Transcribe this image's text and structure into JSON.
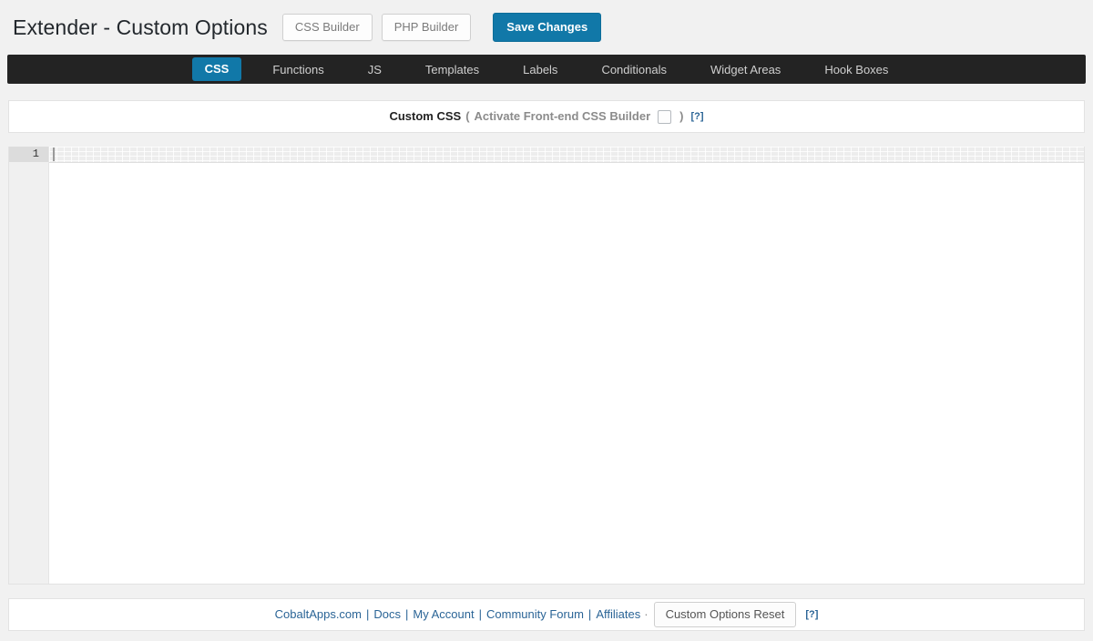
{
  "header": {
    "title": "Extender - Custom Options",
    "buttons": [
      {
        "label": "CSS Builder",
        "name": "css-builder-button"
      },
      {
        "label": "PHP Builder",
        "name": "php-builder-button"
      }
    ],
    "save_label": "Save Changes",
    "accent_color": "#1178a8"
  },
  "navbar": {
    "background_color": "#232323",
    "active_tab": "CSS",
    "tabs": [
      {
        "label": "CSS",
        "active": true
      },
      {
        "label": "Functions",
        "active": false
      },
      {
        "label": "JS",
        "active": false
      },
      {
        "label": "Templates",
        "active": false
      },
      {
        "label": "Labels",
        "active": false
      },
      {
        "label": "Conditionals",
        "active": false
      },
      {
        "label": "Widget Areas",
        "active": false
      },
      {
        "label": "Hook Boxes",
        "active": false
      }
    ]
  },
  "section": {
    "title": "Custom CSS",
    "paren_open": "(",
    "toggle_label": "Activate Front-end CSS Builder",
    "toggle_checked": false,
    "paren_close": ")",
    "help_label": "[?]"
  },
  "editor": {
    "line_numbers": [
      "1"
    ],
    "content": "",
    "active_line": "1",
    "language": "css"
  },
  "footer": {
    "links": [
      {
        "label": "CobaltApps.com"
      },
      {
        "label": "Docs"
      },
      {
        "label": "My Account"
      },
      {
        "label": "Community Forum"
      },
      {
        "label": "Affiliates"
      }
    ],
    "separator": "|",
    "trailing_dot": "·",
    "reset_label": "Custom Options Reset",
    "help_label": "[?]",
    "link_color": "#2a6496"
  }
}
